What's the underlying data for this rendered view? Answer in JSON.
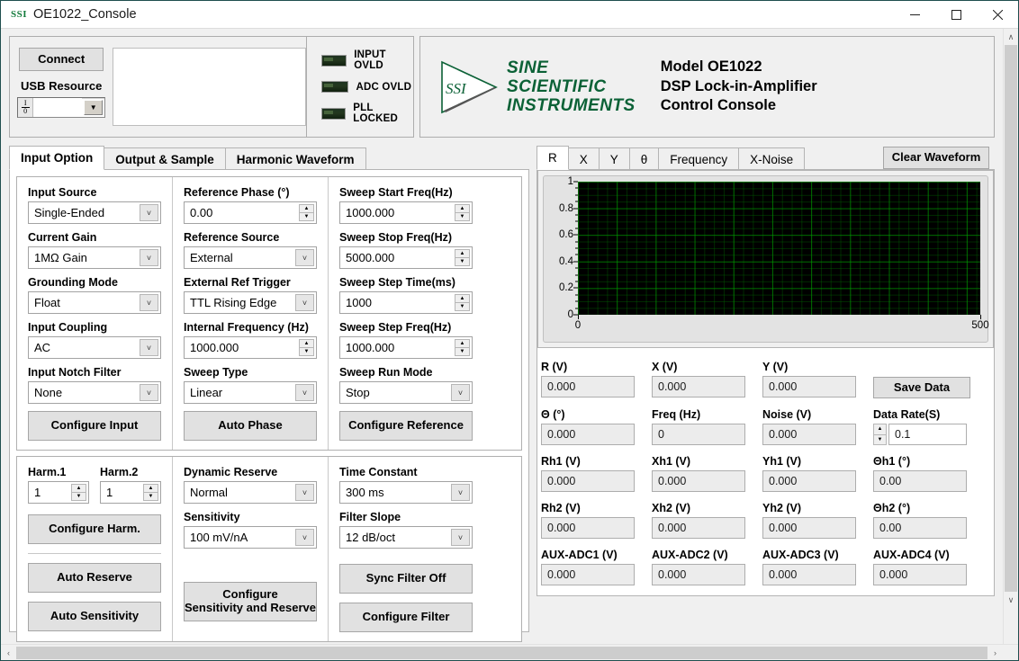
{
  "window": {
    "icon_text": "SSI",
    "title": "OE1022_Console",
    "minimize": "–",
    "maximize": "☐",
    "close": "✕"
  },
  "connection": {
    "connect_label": "Connect",
    "usb_resource_label": "USB Resource",
    "visa_value": "",
    "visa_glyph_top": "I",
    "visa_glyph_bottom": "0",
    "message_box_value": ""
  },
  "indicators": [
    {
      "label": "INPUT OVLD",
      "state": "off",
      "color": "#24381f"
    },
    {
      "label": "ADC  OVLD",
      "state": "off",
      "color": "#24381f"
    },
    {
      "label": "PLL LOCKED",
      "state": "off",
      "color": "#24381f"
    }
  ],
  "branding": {
    "company_line1": "SINE",
    "company_line2": "SCIENTIFIC",
    "company_line3": "INSTRUMENTS",
    "logo_monogram": "SSI",
    "model_line1": "Model OE1022",
    "model_line2": "DSP Lock-in-Amplifier",
    "model_line3": "Control Console",
    "brand_color": "#0b6136"
  },
  "left_tabs": [
    {
      "label": "Input Option",
      "active": true
    },
    {
      "label": "Output & Sample",
      "active": false
    },
    {
      "label": "Harmonic Waveform",
      "active": false
    }
  ],
  "input_option": {
    "column1": [
      {
        "label": "Input Source",
        "value": "Single-Ended",
        "type": "combo"
      },
      {
        "label": "Current Gain",
        "value": "1MΩ Gain",
        "type": "combo"
      },
      {
        "label": "Grounding Mode",
        "value": "Float",
        "type": "combo"
      },
      {
        "label": "Input Coupling",
        "value": "AC",
        "type": "combo"
      },
      {
        "label": "Input Notch Filter",
        "value": "None",
        "type": "combo"
      }
    ],
    "column1_button": "Configure Input",
    "column2": [
      {
        "label": "Reference Phase (°)",
        "value": "0.00",
        "type": "spin"
      },
      {
        "label": "Reference Source",
        "value": "External",
        "type": "combo"
      },
      {
        "label": "External Ref Trigger",
        "value": "TTL Rising Edge",
        "type": "combo"
      },
      {
        "label": "Internal Frequency (Hz)",
        "value": "1000.000",
        "type": "spin"
      },
      {
        "label": "Sweep Type",
        "value": "Linear",
        "type": "combo"
      }
    ],
    "column2_button": "Auto Phase",
    "column3": [
      {
        "label": "Sweep Start Freq(Hz)",
        "value": "1000.000",
        "type": "spin"
      },
      {
        "label": "Sweep Stop Freq(Hz)",
        "value": "5000.000",
        "type": "spin"
      },
      {
        "label": "Sweep Step Time(ms)",
        "value": "1000",
        "type": "spin"
      },
      {
        "label": "Sweep Step Freq(Hz)",
        "value": "1000.000",
        "type": "spin"
      },
      {
        "label": "Sweep Run Mode",
        "value": "Stop",
        "type": "combo"
      }
    ],
    "column3_button": "Configure Reference"
  },
  "harmonics": {
    "harm1_label": "Harm.1",
    "harm1_value": "1",
    "harm2_label": "Harm.2",
    "harm2_value": "1",
    "configure_button": "Configure Harm.",
    "auto_reserve_button": "Auto Reserve",
    "auto_sensitivity_button": "Auto Sensitivity"
  },
  "sensitivity": {
    "dynamic_reserve_label": "Dynamic Reserve",
    "dynamic_reserve_value": "Normal",
    "sensitivity_label": "Sensitivity",
    "sensitivity_value": "100 mV/nA",
    "configure_button_line1": "Configure",
    "configure_button_line2": "Sensitivity and Reserve"
  },
  "filter": {
    "time_constant_label": "Time Constant",
    "time_constant_value": "300 ms",
    "filter_slope_label": "Filter Slope",
    "filter_slope_value": "12 dB/oct",
    "sync_filter_button": "Sync Filter Off",
    "configure_filter_button": "Configure Filter"
  },
  "graph_tabs": [
    {
      "label": "R",
      "active": true
    },
    {
      "label": "X",
      "active": false
    },
    {
      "label": "Y",
      "active": false
    },
    {
      "label": "θ",
      "active": false
    },
    {
      "label": "Frequency",
      "active": false
    },
    {
      "label": "X-Noise",
      "active": false
    }
  ],
  "clear_waveform_button": "Clear Waveform",
  "chart_data": {
    "type": "line",
    "title": "",
    "xlabel": "",
    "ylabel": "",
    "xlim": [
      0,
      500
    ],
    "ylim": [
      0,
      1
    ],
    "x_ticks": [
      0,
      500
    ],
    "y_ticks": [
      0,
      0.2,
      0.4,
      0.6,
      0.8,
      1
    ],
    "y_tick_labels": [
      "0",
      "0.2",
      "0.4",
      "0.6",
      "0.8",
      "1"
    ],
    "x_tick_labels": [
      "0",
      "500"
    ],
    "grid": true,
    "grid_color": "#00a000",
    "plot_background": "#000000",
    "legend": "none",
    "series": [
      {
        "name": "R",
        "x": [],
        "y": []
      }
    ]
  },
  "readouts": {
    "rows": [
      [
        {
          "label": "R (V)",
          "value": "0.000"
        },
        {
          "label": "X (V)",
          "value": "0.000"
        },
        {
          "label": "Y (V)",
          "value": "0.000"
        }
      ],
      [
        {
          "label": "Θ (°)",
          "value": "0.000"
        },
        {
          "label": "Freq (Hz)",
          "value": "0"
        },
        {
          "label": "Noise (V)",
          "value": "0.000"
        }
      ],
      [
        {
          "label": "Rh1 (V)",
          "value": "0.000"
        },
        {
          "label": "Xh1 (V)",
          "value": "0.000"
        },
        {
          "label": "Yh1 (V)",
          "value": "0.000"
        },
        {
          "label": "Θh1 (°)",
          "value": "0.00"
        }
      ],
      [
        {
          "label": "Rh2 (V)",
          "value": "0.000"
        },
        {
          "label": "Xh2 (V)",
          "value": "0.000"
        },
        {
          "label": "Yh2 (V)",
          "value": "0.000"
        },
        {
          "label": "Θh2 (°)",
          "value": "0.00"
        }
      ],
      [
        {
          "label": "AUX-ADC1 (V)",
          "value": "0.000"
        },
        {
          "label": "AUX-ADC2 (V)",
          "value": "0.000"
        },
        {
          "label": "AUX-ADC3 (V)",
          "value": "0.000"
        },
        {
          "label": "AUX-ADC4 (V)",
          "value": "0.000"
        }
      ]
    ],
    "save_data_button": "Save Data",
    "data_rate_label": "Data Rate(S)",
    "data_rate_value": "0.1"
  },
  "scrollbars": {
    "up_arrow": "∧",
    "down_arrow": "∨",
    "left_arrow": "‹",
    "right_arrow": "›"
  }
}
